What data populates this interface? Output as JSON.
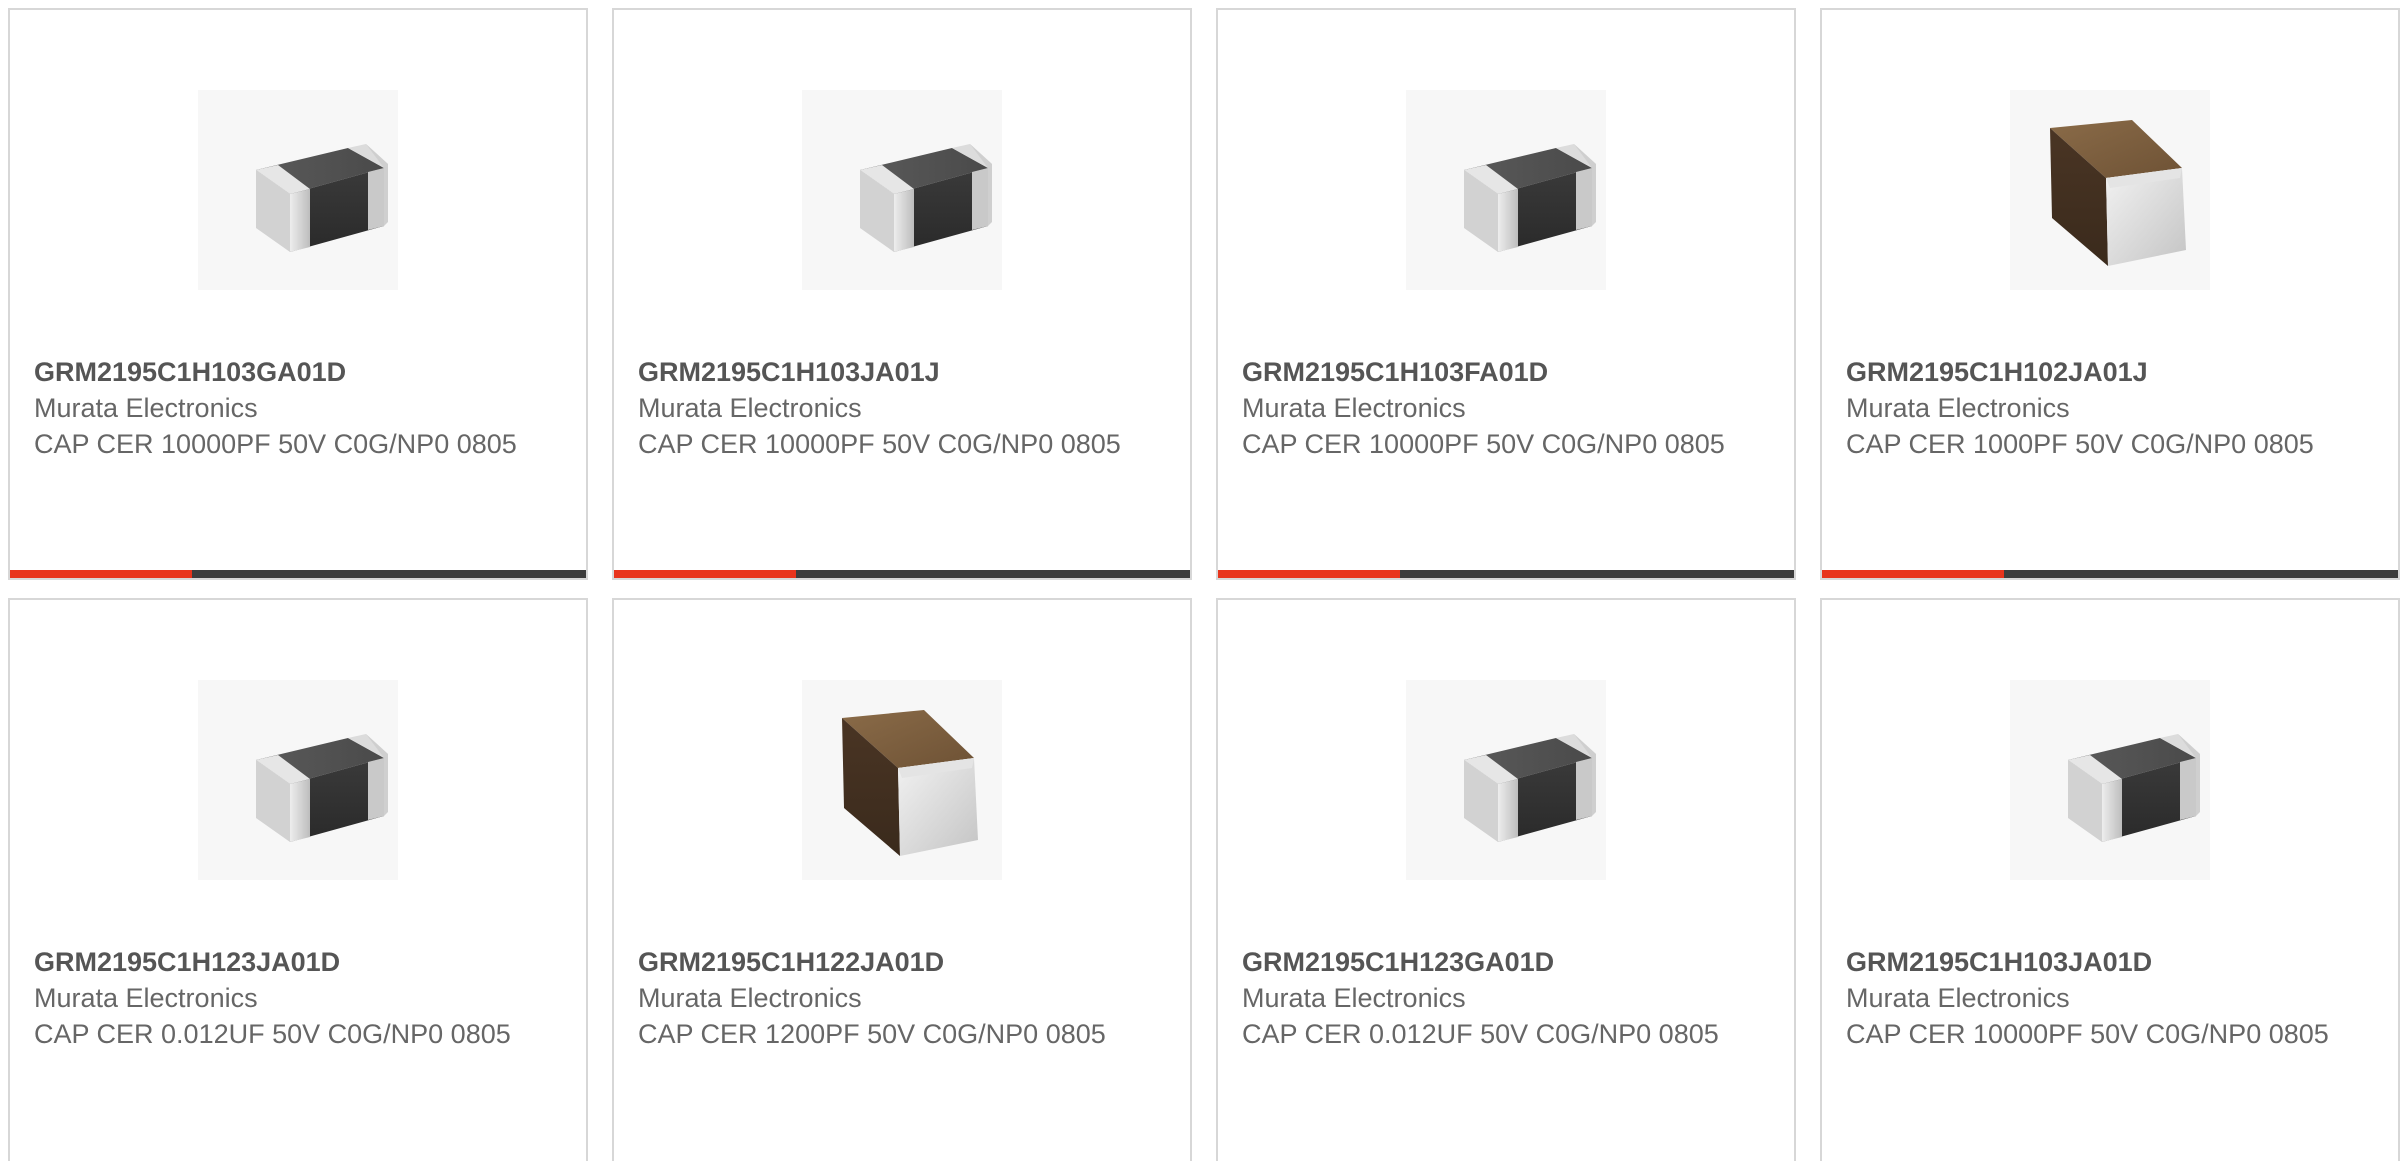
{
  "theme": {
    "accent": "#e8341c",
    "bar_dark": "#3d3d3d"
  },
  "products": [
    {
      "part_number": "GRM2195C1H103GA01D",
      "manufacturer": "Murata Electronics",
      "description": "CAP CER 10000PF 50V C0G/NP0 0805",
      "image_icon": "mlcc-chip-gray-icon"
    },
    {
      "part_number": "GRM2195C1H103JA01J",
      "manufacturer": "Murata Electronics",
      "description": "CAP CER 10000PF 50V C0G/NP0 0805",
      "image_icon": "mlcc-chip-gray-icon"
    },
    {
      "part_number": "GRM2195C1H103FA01D",
      "manufacturer": "Murata Electronics",
      "description": "CAP CER 10000PF 50V C0G/NP0 0805",
      "image_icon": "mlcc-chip-gray-icon"
    },
    {
      "part_number": "GRM2195C1H102JA01J",
      "manufacturer": "Murata Electronics",
      "description": "CAP CER 1000PF 50V C0G/NP0 0805",
      "image_icon": "mlcc-chip-brown-icon"
    },
    {
      "part_number": "GRM2195C1H123JA01D",
      "manufacturer": "Murata Electronics",
      "description": "CAP CER 0.012UF 50V C0G/NP0 0805",
      "image_icon": "mlcc-chip-gray-icon"
    },
    {
      "part_number": "GRM2195C1H122JA01D",
      "manufacturer": "Murata Electronics",
      "description": "CAP CER 1200PF 50V C0G/NP0 0805",
      "image_icon": "mlcc-chip-brown-icon"
    },
    {
      "part_number": "GRM2195C1H123GA01D",
      "manufacturer": "Murata Electronics",
      "description": "CAP CER 0.012UF 50V C0G/NP0 0805",
      "image_icon": "mlcc-chip-gray-icon"
    },
    {
      "part_number": "GRM2195C1H103JA01D",
      "manufacturer": "Murata Electronics",
      "description": "CAP CER 10000PF 50V C0G/NP0 0805",
      "image_icon": "mlcc-chip-gray-icon"
    }
  ]
}
